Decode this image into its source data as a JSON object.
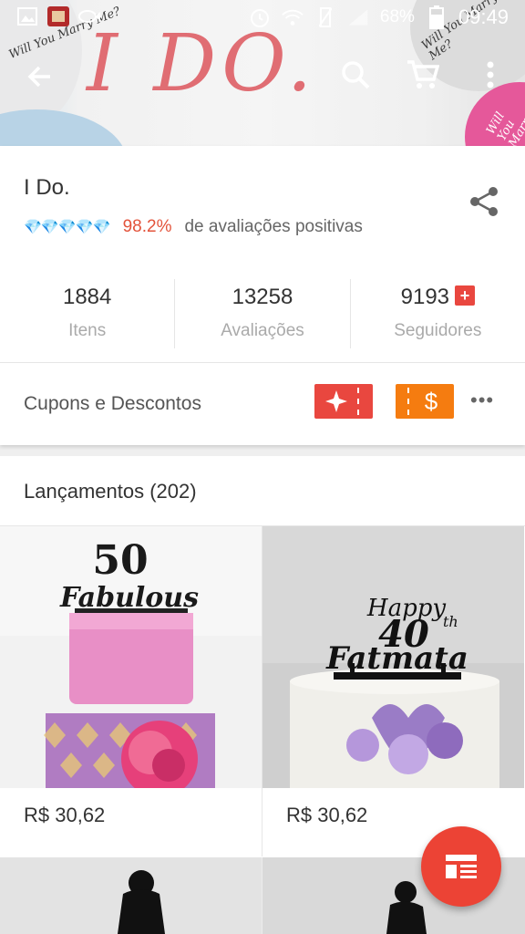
{
  "status_bar": {
    "battery": "68%",
    "time": "09:49"
  },
  "banner": {
    "logo_text": "I DO.",
    "balloon_text_left": "Will You Marry Me?",
    "balloon_text_right": "Will You Marry Me?",
    "balloon_text_bottom": "Will You Marry"
  },
  "store": {
    "name": "I Do.",
    "diamonds": "💎💎💎💎💎",
    "rating_percent": "98.2%",
    "rating_label": "de avaliações positivas",
    "stats": [
      {
        "value": "1884",
        "label": "Itens"
      },
      {
        "value": "13258",
        "label": "Avaliações"
      },
      {
        "value": "9193",
        "label": "Seguidores"
      }
    ],
    "follow_plus": "+",
    "coupons_label": "Cupons e Descontos",
    "coupon2_symbol": "$",
    "more": "•••"
  },
  "new_arrivals": {
    "title": "Lançamentos (202)",
    "products": [
      {
        "topper_line1": "50",
        "topper_line2": "Fabulous",
        "price": "R$ 30,62"
      },
      {
        "topper_line1": "Happy",
        "topper_line2": "40",
        "topper_sup": "th",
        "topper_line3": "Fatmata",
        "price": "R$ 30,62"
      }
    ]
  },
  "colors": {
    "accent_red": "#e9473f",
    "accent_orange": "#f57c10",
    "fab_red": "#ec4335",
    "rating_red": "#e3533b",
    "diamond_blue": "#32a6e2"
  }
}
